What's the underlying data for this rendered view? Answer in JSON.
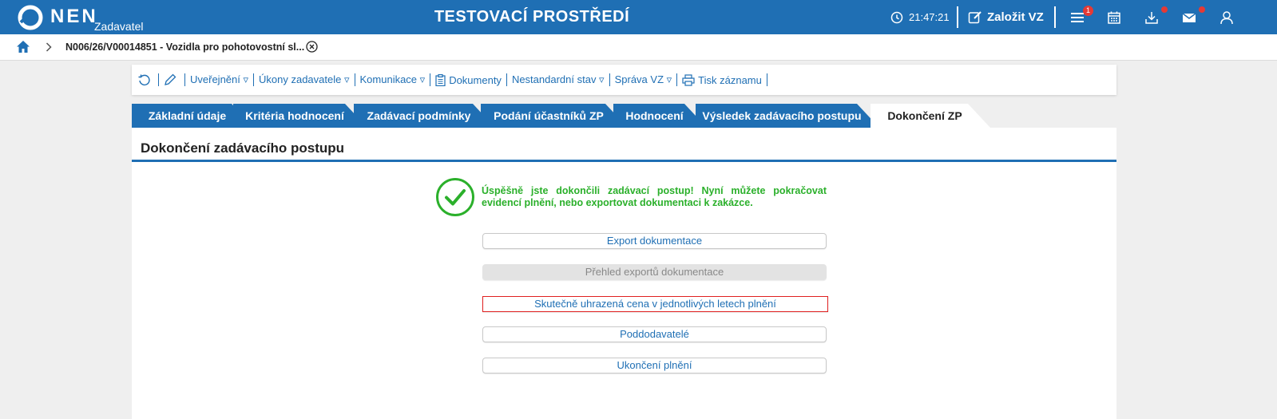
{
  "header": {
    "logo_text": "NEN",
    "logo_sub": "Zadavatel",
    "env_title": "TESTOVACÍ PROSTŘEDÍ",
    "clock": "21:47:21",
    "create_label": "Založit VZ",
    "menu_badge": "1"
  },
  "breadcrumb": {
    "title": "N006/26/V00014851 - Vozidla pro pohotovostní sl..."
  },
  "toolbar": {
    "items": [
      "Uveřejnění ▿",
      "Úkony zadavatele ▿",
      "Komunikace ▿",
      "Dokumenty",
      "Nestandardní stav ▿",
      "Správa VZ ▿",
      "Tisk záznamu"
    ]
  },
  "tabs": [
    "Základní údaje",
    "Kritéria hodnocení",
    "Zadávací podmínky",
    "Podání účastníků ZP",
    "Hodnocení",
    "Výsledek zadávacího postupu",
    "Dokončení ZP"
  ],
  "panel": {
    "title": "Dokončení zadávacího postupu",
    "success_message": "Úspěšně jste dokončili zadávací postup! Nyní můžete pokračovat evidencí plnění, nebo exportovat dokumentaci k zakázce.",
    "buttons": [
      "Export dokumentace",
      "Přehled exportů dokumentace",
      "Skutečně uhrazená cena v jednotlivých letech plnění",
      "Poddodavatelé",
      "Ukončení plnění"
    ]
  },
  "colors": {
    "brand": "#1f6fb4",
    "success": "#2bb02b",
    "alert": "#e53935"
  }
}
